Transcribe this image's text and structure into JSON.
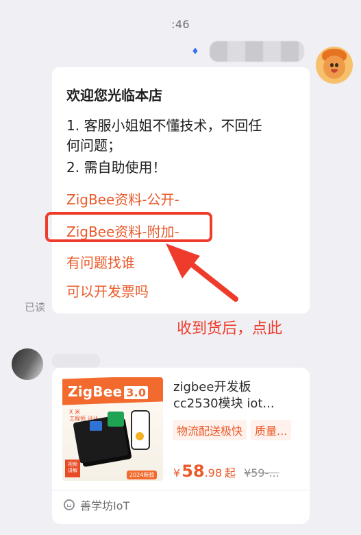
{
  "timestamp": ":46",
  "read_receipt": "已读",
  "welcome": {
    "title": "欢迎您光临本店",
    "rule_1_line_1": "1. 客服小姐姐不懂技术，不回任",
    "rule_1_line_2": "何问题；",
    "rule_2": "2. 需自助使用！",
    "links": [
      "ZigBee资料-公开-",
      "ZigBee资料-附加-",
      "有问题找谁",
      "可以开发票吗"
    ]
  },
  "annotation": "收到货后，点此",
  "product": {
    "image_brand": "ZigBee",
    "image_version": "3.0",
    "image_subtitle_1": "X 米",
    "image_subtitle_2": "工程师  设计",
    "image_tag": "视频\n讲解",
    "image_year": "2024新款",
    "title_line_1": "zigbee开发板",
    "title_line_2": "cc2530模块 iot...",
    "tags": [
      "物流配送极快",
      "质量..."
    ],
    "price_currency": "¥",
    "price_int": "58",
    "price_dec": ".98",
    "price_suffix": "起",
    "price_original": "¥59-...",
    "shop_name": "善学坊IoT"
  },
  "icons": {
    "sender_badge": "shield-badge-icon",
    "shop": "shop-icon"
  },
  "colors": {
    "accent": "#ea5a2a",
    "annotation": "#ef3b2c",
    "background": "#efeff4",
    "bubble": "#ffffff"
  }
}
